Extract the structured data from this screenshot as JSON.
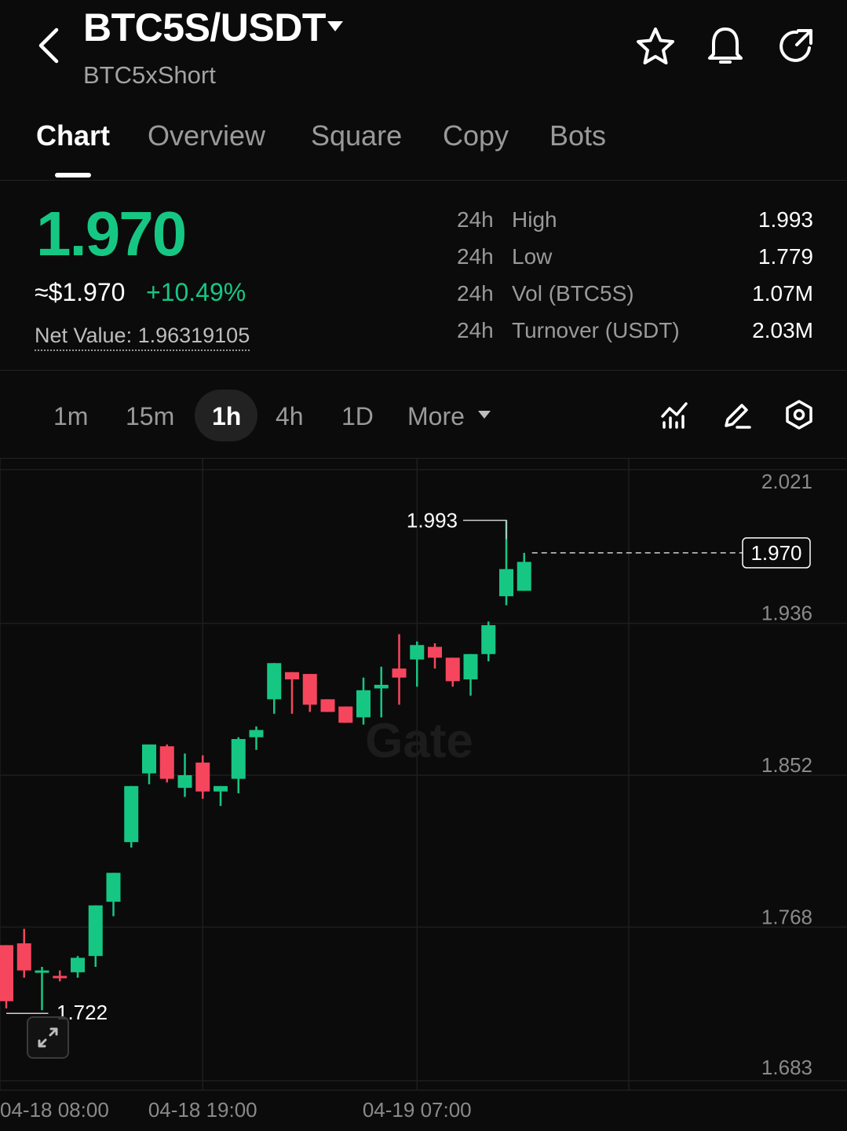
{
  "header": {
    "pair": "BTC5S/USDT",
    "subtitle": "BTC5xShort",
    "icons": [
      "back-chevron-icon",
      "star-icon",
      "bell-icon",
      "share-icon"
    ]
  },
  "tabs": [
    "Chart",
    "Overview",
    "Square",
    "Copy",
    "Bots"
  ],
  "active_tab": "Chart",
  "price": {
    "last": "1.970",
    "usd": "≈$1.970",
    "change": "+10.49%",
    "net_value_label": "Net Value: 1.96319105"
  },
  "stats": [
    {
      "period": "24h",
      "label": "High",
      "value": "1.993"
    },
    {
      "period": "24h",
      "label": "Low",
      "value": "1.779"
    },
    {
      "period": "24h",
      "label": "Vol (BTC5S)",
      "value": "1.07M"
    },
    {
      "period": "24h",
      "label": "Turnover (USDT)",
      "value": "2.03M"
    }
  ],
  "intervals": [
    "1m",
    "15m",
    "1h",
    "4h",
    "1D",
    "More"
  ],
  "active_interval": "1h",
  "tool_icons": [
    "indicator-icon",
    "draw-pencil-icon",
    "settings-hex-icon"
  ],
  "colors": {
    "up": "#16c784",
    "down": "#f6465d",
    "background": "#0b0b0b",
    "grid": "#1e1e1e"
  },
  "watermark": "Gate",
  "chart_data": {
    "type": "candlestick",
    "interval": "1h",
    "ylim": [
      1.683,
      2.021
    ],
    "y_ticks": [
      "2.021",
      "1.936",
      "1.852",
      "1.768",
      "1.683"
    ],
    "x_ticks": [
      {
        "label": "04-18 08:00",
        "index": 0
      },
      {
        "label": "04-18 19:00",
        "index": 11
      },
      {
        "label": "04-19 07:00",
        "index": 23
      }
    ],
    "last_price_label": "1.970",
    "high_marker": {
      "label": "1.993",
      "index": 28
    },
    "low_marker": {
      "label": "1.722",
      "index": 2
    },
    "candles": [
      {
        "o": 1.758,
        "h": 1.758,
        "l": 1.723,
        "c": 1.727
      },
      {
        "o": 1.759,
        "h": 1.767,
        "l": 1.74,
        "c": 1.744
      },
      {
        "o": 1.744,
        "h": 1.746,
        "l": 1.722,
        "c": 1.744
      },
      {
        "o": 1.741,
        "h": 1.744,
        "l": 1.738,
        "c": 1.74
      },
      {
        "o": 1.743,
        "h": 1.752,
        "l": 1.74,
        "c": 1.751
      },
      {
        "o": 1.752,
        "h": 1.767,
        "l": 1.746,
        "c": 1.78
      },
      {
        "o": 1.782,
        "h": 1.796,
        "l": 1.774,
        "c": 1.798
      },
      {
        "o": 1.815,
        "h": 1.831,
        "l": 1.812,
        "c": 1.846
      },
      {
        "o": 1.853,
        "h": 1.867,
        "l": 1.847,
        "c": 1.869
      },
      {
        "o": 1.868,
        "h": 1.869,
        "l": 1.848,
        "c": 1.85
      },
      {
        "o": 1.845,
        "h": 1.864,
        "l": 1.84,
        "c": 1.852
      },
      {
        "o": 1.859,
        "h": 1.863,
        "l": 1.839,
        "c": 1.843
      },
      {
        "o": 1.843,
        "h": 1.846,
        "l": 1.835,
        "c": 1.846
      },
      {
        "o": 1.85,
        "h": 1.873,
        "l": 1.842,
        "c": 1.872
      },
      {
        "o": 1.873,
        "h": 1.879,
        "l": 1.866,
        "c": 1.877
      },
      {
        "o": 1.894,
        "h": 1.911,
        "l": 1.886,
        "c": 1.914
      },
      {
        "o": 1.909,
        "h": 1.898,
        "l": 1.886,
        "c": 1.905
      },
      {
        "o": 1.908,
        "h": 1.904,
        "l": 1.887,
        "c": 1.891
      },
      {
        "o": 1.894,
        "h": 1.891,
        "l": 1.887,
        "c": 1.887
      },
      {
        "o": 1.89,
        "h": 1.881,
        "l": 1.881,
        "c": 1.881
      },
      {
        "o": 1.884,
        "h": 1.906,
        "l": 1.88,
        "c": 1.899
      },
      {
        "o": 1.9,
        "h": 1.912,
        "l": 1.884,
        "c": 1.902
      },
      {
        "o": 1.911,
        "h": 1.93,
        "l": 1.891,
        "c": 1.906
      },
      {
        "o": 1.916,
        "h": 1.926,
        "l": 1.901,
        "c": 1.924
      },
      {
        "o": 1.923,
        "h": 1.925,
        "l": 1.911,
        "c": 1.917
      },
      {
        "o": 1.917,
        "h": 1.91,
        "l": 1.901,
        "c": 1.904
      },
      {
        "o": 1.905,
        "h": 1.918,
        "l": 1.896,
        "c": 1.919
      },
      {
        "o": 1.919,
        "h": 1.937,
        "l": 1.915,
        "c": 1.935
      },
      {
        "o": 1.951,
        "h": 1.993,
        "l": 1.946,
        "c": 1.966
      },
      {
        "o": 1.954,
        "h": 1.975,
        "l": 1.955,
        "c": 1.97
      }
    ]
  }
}
